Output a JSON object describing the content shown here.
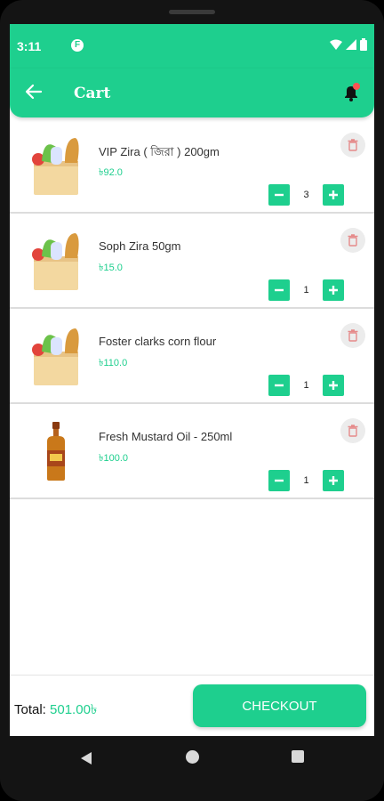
{
  "status_bar": {
    "time": "3:11",
    "notification_icon": "F"
  },
  "app_bar": {
    "title": "Cart",
    "back_icon": "arrow-left",
    "bell_icon": "bell-with-red-dot"
  },
  "items": [
    {
      "name": "VIP Zira ( জিরা ) 200gm",
      "price": "৳92.0",
      "quantity": "3",
      "image": "grocery-bag"
    },
    {
      "name": "Soph Zira 50gm",
      "price": "৳15.0",
      "quantity": "1",
      "image": "grocery-bag"
    },
    {
      "name": "Foster clarks corn flour",
      "price": "৳110.0",
      "quantity": "1",
      "image": "grocery-bag"
    },
    {
      "name": "Fresh Mustard Oil - 250ml",
      "price": "৳100.0",
      "quantity": "1",
      "image": "mustard-oil-bottle"
    }
  ],
  "footer": {
    "total_label": "Total:",
    "total_value": "501.00৳",
    "checkout_label": "CHECKOUT"
  },
  "colors": {
    "primary": "#1ecf8e",
    "delete_icon": "#e58a8a",
    "badge": "#ff5252"
  }
}
